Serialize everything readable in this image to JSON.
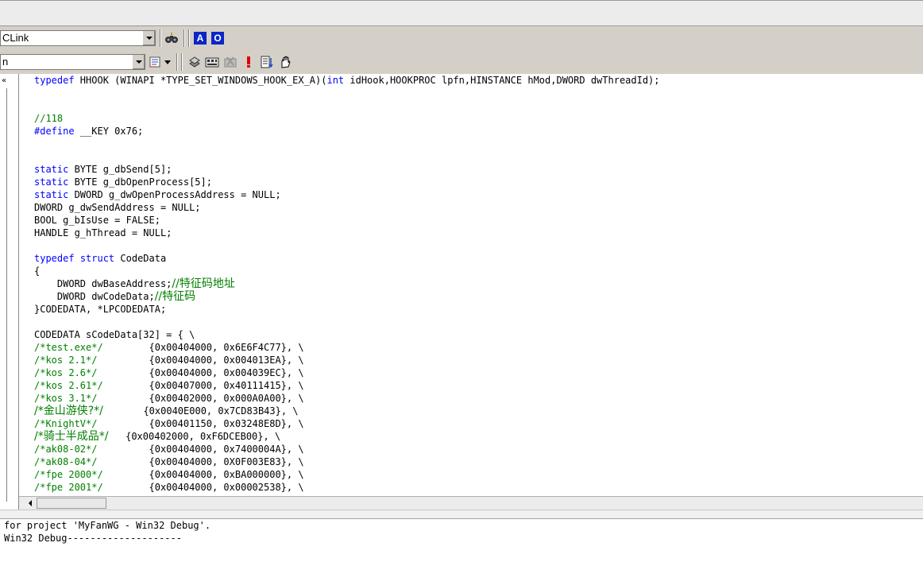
{
  "toolbar1": {
    "class_combo_value": "CLink",
    "a_button_label": "A",
    "o_button_label": "O"
  },
  "toolbar2": {
    "function_combo_value": "n"
  },
  "leftbar": {
    "chevron": "«"
  },
  "editor": {
    "lines": [
      "typedef HHOOK (WINAPI *TYPE_SET_WINDOWS_HOOK_EX_A)(int idHook,HOOKPROC lpfn,HINSTANCE hMod,DWORD dwThreadId);",
      "",
      "",
      "//118",
      "#define __KEY 0x76;",
      "",
      "",
      "static BYTE g_dbSend[5];",
      "static BYTE g_dbOpenProcess[5];",
      "static DWORD g_dwOpenProcessAddress = NULL;",
      "DWORD g_dwSendAddress = NULL;",
      "BOOL g_bIsUse = FALSE;",
      "HANDLE g_hThread = NULL;",
      "",
      "typedef struct CodeData",
      "{",
      "    DWORD dwBaseAddress;//特征码地址",
      "    DWORD dwCodeData;//特征码",
      "}CODEDATA, *LPCODEDATA;",
      "",
      "CODEDATA sCodeData[32] = { \\",
      "/*test.exe*/        {0x00404000, 0x6E6F4C77}, \\",
      "/*kos 2.1*/         {0x00404000, 0x004013EA}, \\",
      "/*kos 2.6*/         {0x00404000, 0x004039EC}, \\",
      "/*kos 2.61*/        {0x00407000, 0x40111415}, \\",
      "/*kos 3.1*/         {0x00402000, 0x000A0A00}, \\",
      "/*金山游侠?*/        {0x0040E000, 0x7CD83B43}, \\",
      "/*KnightV*/         {0x00401150, 0x03248E8D}, \\",
      "/*骑士半成品*/       {0x00402000, 0xF6DCEB00}, \\",
      "/*ak08-02*/         {0x00404000, 0x7400004A}, \\",
      "/*ak08-04*/         {0x00404000, 0X0F003E83}, \\",
      "/*fpe 2000*/        {0x00404000, 0xBA000000}, \\",
      "/*fpe 2001*/        {0x00404000, 0x00002538}, \\"
    ]
  },
  "output": {
    "line1": "for project 'MyFanWG - Win32 Debug'.",
    "line2": "Win32 Debug--------------------"
  },
  "icons": [
    "find-binoculars-icon",
    "function-list-icon",
    "wizard-icon",
    "compile-icon",
    "build-icon",
    "stop-build-icon",
    "execute-icon",
    "go-debug-icon",
    "breakpoint-hand-icon"
  ]
}
